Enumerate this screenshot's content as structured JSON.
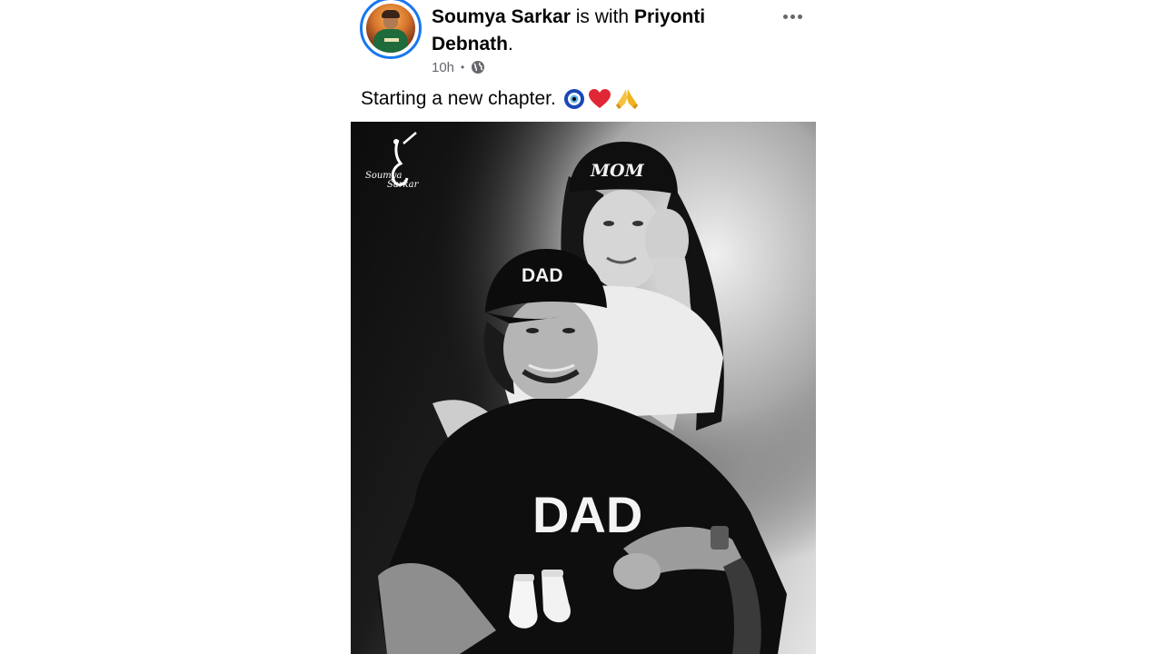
{
  "post": {
    "author": "Soumya Sarkar",
    "with_text": "is with",
    "tagged_name_line1": "Priyonti",
    "tagged_name_line2": "Debnath",
    "period": ".",
    "time_ago": "10h",
    "separator": "•",
    "privacy_icon": "globe-icon",
    "more_icon": "more-options-icon",
    "caption": "Starting a new chapter.",
    "caption_emojis": [
      "nazar-amulet-emoji",
      "red-heart-emoji",
      "folded-hands-emoji"
    ]
  },
  "photo": {
    "watermark_line1": "Soumya",
    "watermark_line2": "Sarkar",
    "cap_mom_text": "MOM",
    "cap_dad_text": "DAD",
    "shirt_text": "DAD"
  },
  "colors": {
    "story_ring": "#1877f2",
    "text_primary": "#050505",
    "text_secondary": "#65676b"
  }
}
